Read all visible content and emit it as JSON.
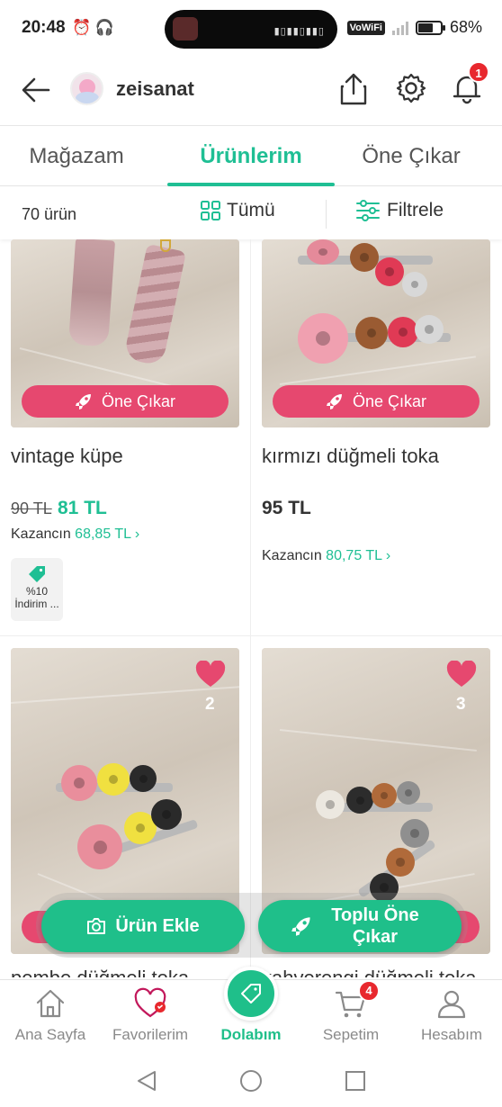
{
  "status_bar": {
    "time": "20:48",
    "left_icons": "⏰ 🎧",
    "vowifi": "VoWiFi",
    "battery": "68%",
    "battery_level": 0.68
  },
  "header": {
    "store_name": "zeisanat",
    "notification_count": "1"
  },
  "tabs": [
    {
      "label": "Mağazam"
    },
    {
      "label": "Ürünlerim"
    },
    {
      "label": "Öne Çıkar"
    }
  ],
  "filters": {
    "count": "70 ürün",
    "all_label": "Tümü",
    "filter_label": "Filtrele"
  },
  "products": [
    {
      "title": "vintage küpe",
      "promo_label": "Öne Çıkar",
      "old_price": "90 TL",
      "new_price": "81 TL",
      "earning_label": "Kazancın",
      "earning_value": "68,85 TL",
      "discount_line1": "%10",
      "discount_line2": "İndirim ..."
    },
    {
      "title": "kırmızı düğmeli toka",
      "promo_label": "Öne Çıkar",
      "price": "95 TL",
      "earning_label": "Kazancın",
      "earning_value": "80,75 TL"
    },
    {
      "title": "pembe düğmeli toka",
      "like_count": "2"
    },
    {
      "title": "kahverengi düğmeli toka",
      "like_count": "3"
    }
  ],
  "actions": {
    "add_product": "Ürün Ekle",
    "bulk_promote": "Toplu Öne Çıkar"
  },
  "bottom_nav": [
    {
      "label": "Ana Sayfa",
      "icon": "home-icon"
    },
    {
      "label": "Favorilerim",
      "icon": "heart-icon"
    },
    {
      "label": "Dolabım",
      "icon": "tag-icon"
    },
    {
      "label": "Sepetim",
      "icon": "cart-icon",
      "badge": "4"
    },
    {
      "label": "Hesabım",
      "icon": "user-icon"
    }
  ],
  "colors": {
    "accent": "#1fbf94",
    "promo": "#e6486f",
    "badge": "#e8282e"
  }
}
